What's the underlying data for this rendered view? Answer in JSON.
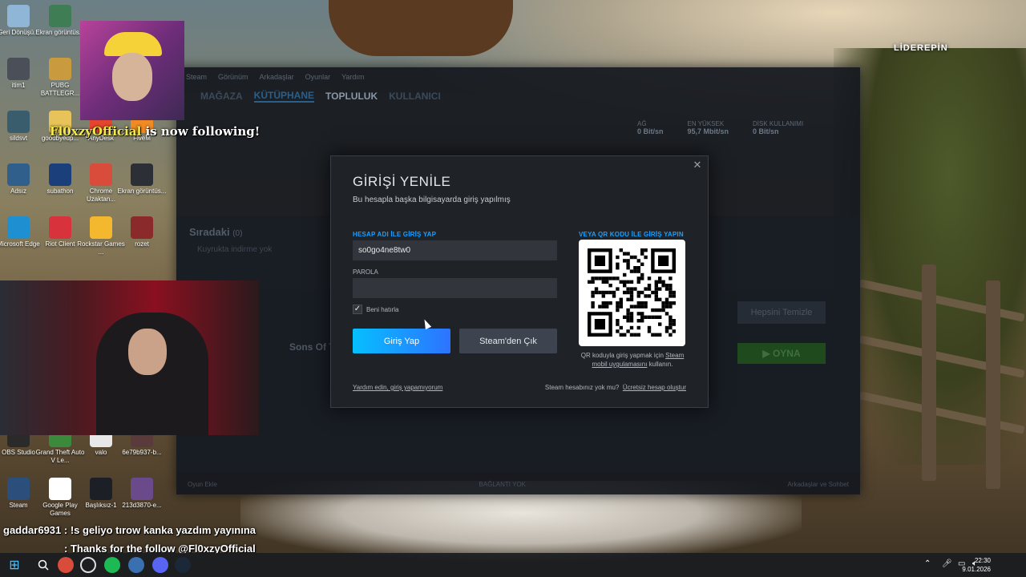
{
  "desktop": {
    "icons": [
      {
        "label": "Geri Dönüşü...",
        "icon": "recycle-bin-icon",
        "color": "#8fb6d6"
      },
      {
        "label": "Ekran görüntüs...",
        "icon": "screenshot-icon",
        "color": "#3f7d54"
      },
      {
        "label": "itim1",
        "icon": "file-icon",
        "color": "#4a4f58"
      },
      {
        "label": "PUBG BATTLEGR...",
        "icon": "pubg-icon",
        "color": "#c99a3e"
      },
      {
        "label": "sildsvt",
        "icon": "image-icon",
        "color": "#3a5d6e"
      },
      {
        "label": "goodbyedp...",
        "icon": "folder-icon",
        "color": "#e7c35a"
      },
      {
        "label": "AnyDesk",
        "icon": "anydesk-icon",
        "color": "#e5452f"
      },
      {
        "label": "FiveM",
        "icon": "fivem-icon",
        "color": "#f08a24"
      },
      {
        "label": "Adsız",
        "icon": "image-icon",
        "color": "#2f5f8a"
      },
      {
        "label": "subathon",
        "icon": "photoshop-icon",
        "color": "#1b3f7a"
      },
      {
        "label": "Chrome Uzaktan...",
        "icon": "chrome-remote-icon",
        "color": "#d94b3b"
      },
      {
        "label": "Ekran görüntüs...",
        "icon": "screenshot-icon",
        "color": "#2c2f36"
      },
      {
        "label": "Microsoft Edge",
        "icon": "edge-icon",
        "color": "#1e8fd1"
      },
      {
        "label": "Riot Client",
        "icon": "riot-icon",
        "color": "#d8333c"
      },
      {
        "label": "Rockstar Games ...",
        "icon": "rockstar-icon",
        "color": "#f3b82e"
      },
      {
        "label": "rozet",
        "icon": "image-icon",
        "color": "#8a2a2a"
      },
      {
        "label": "OBS Studio",
        "icon": "obs-icon",
        "color": "#2a2a2a"
      },
      {
        "label": "Grand Theft Auto V Le...",
        "icon": "gta-icon",
        "color": "#3b8a3b"
      },
      {
        "label": "valo",
        "icon": "text-file-icon",
        "color": "#e8e8e8"
      },
      {
        "label": "6e79b937-b...",
        "icon": "image-icon",
        "color": "#5a3a3a"
      },
      {
        "label": "Steam",
        "icon": "steam-icon",
        "color": "#2b4f7a"
      },
      {
        "label": "Google Play Games",
        "icon": "document-icon",
        "color": "#ffffff"
      },
      {
        "label": "Başlıksız-1",
        "icon": "image-icon",
        "color": "#1c1f26"
      },
      {
        "label": "213d3870-e...",
        "icon": "image-icon",
        "color": "#6a4a8a"
      }
    ]
  },
  "overlay": {
    "follow_name": "Fl0xzyOfficial",
    "follow_text": " is now following!",
    "chat": [
      {
        "user": "gaddar6931",
        "message": ": !s geliyo tırow kanka yazdım yayınına"
      },
      {
        "user": "",
        "message": ": Thanks for the follow @Fl0xzyOfficial"
      }
    ],
    "brand": "LİDEREPİN"
  },
  "steam": {
    "menu": [
      "Steam",
      "Görünüm",
      "Arkadaşlar",
      "Oyunlar",
      "Yardım"
    ],
    "nav": {
      "store": "MAĞAZA",
      "library": "KÜTÜPHANE",
      "community": "TOPLULUK",
      "profile": "KULLANICI"
    },
    "stats": [
      {
        "label": "AĞ",
        "value": "0 Bit/sn"
      },
      {
        "label": "EN YÜKSEK",
        "value": "95,7 Mbit/sn"
      },
      {
        "label": "DİSK KULLANIMI",
        "value": "0 Bit/sn"
      }
    ],
    "queue_title": "Sıradaki",
    "queue_count": "(0)",
    "queue_sub": "Kuyrukta indirme yok",
    "clear_all": "Hepsini Temizle",
    "game_title": "Sons Of T",
    "play": "▶ OYNA",
    "footer_left": "Oyun Ekle",
    "footer_center": "BAĞLANTI YOK",
    "footer_right": "Arkadaşlar ve Sohbet"
  },
  "dialog": {
    "title": "GİRİŞİ YENİLE",
    "subtitle": "Bu hesapla başka bilgisayarda giriş yapılmış",
    "account_label": "HESAP ADI İLE GİRİŞ YAP",
    "account_value": "so0go4ne8tw0",
    "password_label": "PAROLA",
    "password_value": "",
    "remember": "Beni hatırla",
    "remember_checked": true,
    "login_button": "Giriş Yap",
    "exit_button": "Steam'den Çık",
    "qr_label": "VEYA QR KODU İLE GİRİŞ YAPIN",
    "qr_caption_pre": "QR koduyla giriş yapmak için ",
    "qr_caption_link": "Steam mobil uygulamasını",
    "qr_caption_post": " kullanın.",
    "help_link": "Yardım edin, giriş yapamıyorum",
    "no_account": "Steam hesabınız yok mu?",
    "create_account": "Ücretsiz hesap oluştur"
  },
  "taskbar": {
    "start": "⊞",
    "apps": [
      "search-icon",
      "chrome-icon",
      "obs-icon",
      "spotify-icon",
      "network-icon",
      "discord-icon",
      "steam-icon"
    ],
    "time": "22:30",
    "date": "9.01.2026"
  }
}
